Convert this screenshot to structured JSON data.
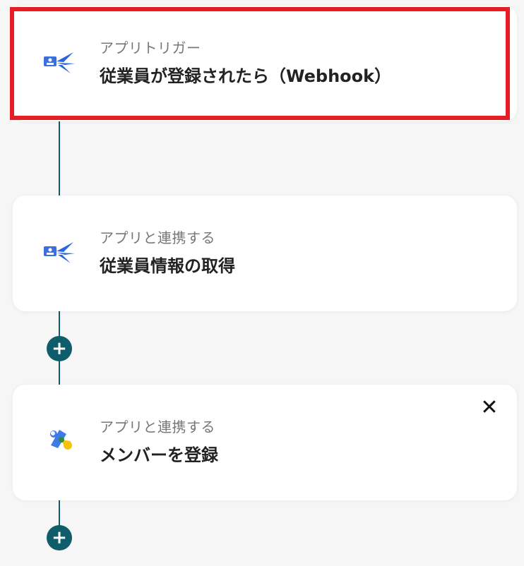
{
  "steps": [
    {
      "sub": "アプリトリガー",
      "title": "従業員が登録されたら（Webhook）",
      "icon": "smarthr-app-icon"
    },
    {
      "sub": "アプリと連携する",
      "title": "従業員情報の取得",
      "icon": "smarthr-app-icon"
    },
    {
      "sub": "アプリと連携する",
      "title": "メンバーを登録",
      "icon": "google-workspace-icon"
    }
  ],
  "add_step_symbol": "+",
  "close_symbol": "✕",
  "colors": {
    "connector": "#0f5c6b",
    "highlight": "#e51e25"
  }
}
